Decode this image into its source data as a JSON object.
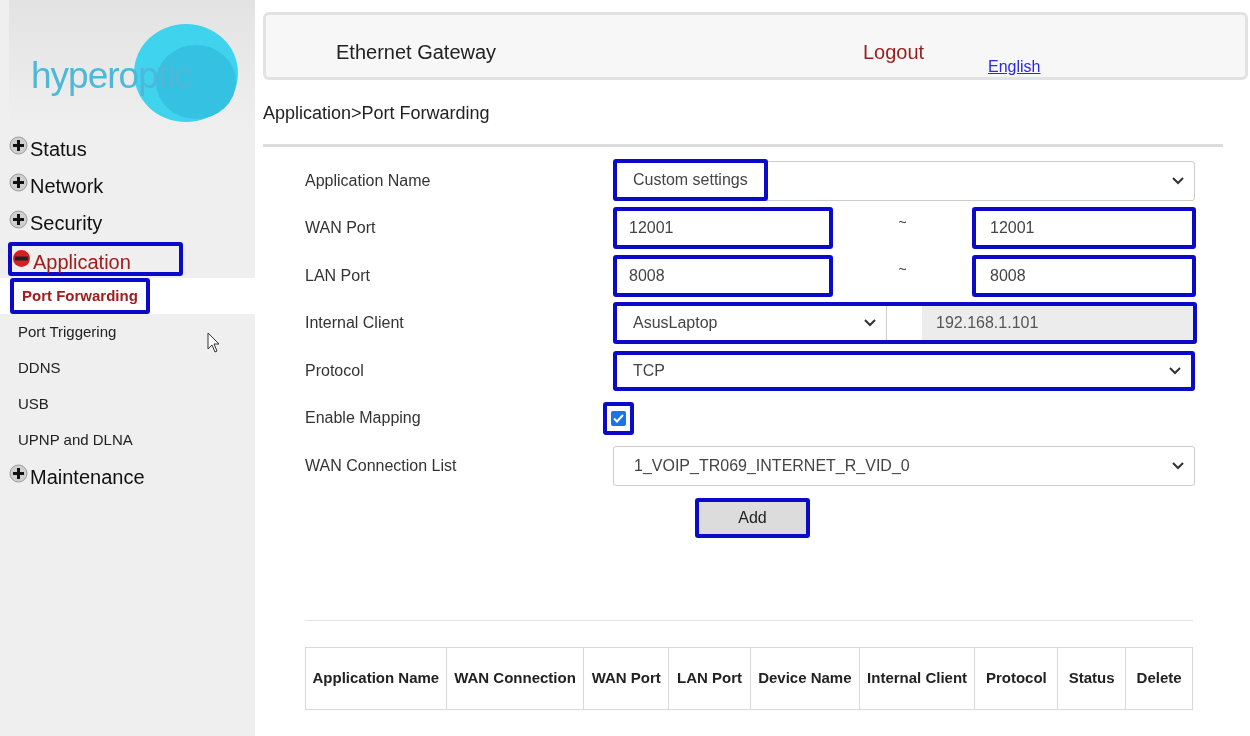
{
  "logo": {
    "text": "hyperoptic"
  },
  "sidebar": {
    "items": [
      {
        "label": "Status",
        "expanded": false,
        "highlighted": false
      },
      {
        "label": "Network",
        "expanded": false,
        "highlighted": false
      },
      {
        "label": "Security",
        "expanded": false,
        "highlighted": false
      },
      {
        "label": "Application",
        "expanded": true,
        "highlighted": true,
        "children": [
          {
            "label": "Port Forwarding",
            "selected": true,
            "highlighted": true
          },
          {
            "label": "Port Triggering",
            "selected": false,
            "highlighted": false
          },
          {
            "label": "DDNS",
            "selected": false,
            "highlighted": false
          },
          {
            "label": "USB",
            "selected": false,
            "highlighted": false
          },
          {
            "label": "UPNP and DLNA",
            "selected": false,
            "highlighted": false
          }
        ]
      },
      {
        "label": "Maintenance",
        "expanded": false,
        "highlighted": false
      }
    ]
  },
  "header": {
    "title": "Ethernet Gateway",
    "logout": "Logout",
    "language": "English"
  },
  "breadcrumb": "Application>Port Forwarding",
  "form": {
    "rows": [
      {
        "kind": "select",
        "label": "Application Name",
        "value": "Custom settings",
        "highlighted": false,
        "value_highlighted": true
      },
      {
        "kind": "range",
        "label": "WAN Port",
        "from": "12001",
        "separator": "~",
        "to": "12001",
        "highlighted": true
      },
      {
        "kind": "range",
        "label": "LAN Port",
        "from": "8008",
        "separator": "~",
        "to": "8008",
        "highlighted": true
      },
      {
        "kind": "client",
        "label": "Internal Client",
        "device": "AsusLaptop",
        "ip": "192.168.1.101",
        "highlighted": true
      },
      {
        "kind": "select",
        "label": "Protocol",
        "value": "TCP",
        "highlighted": true,
        "value_highlighted": false
      },
      {
        "kind": "checkbox",
        "label": "Enable Mapping",
        "checked": true,
        "highlighted": true
      },
      {
        "kind": "select",
        "label": "WAN Connection List",
        "value": "1_VOIP_TR069_INTERNET_R_VID_0",
        "highlighted": false,
        "value_highlighted": false
      }
    ]
  },
  "add_button": {
    "label": "Add",
    "highlighted": true
  },
  "table": {
    "columns": [
      "Application Name",
      "WAN Connection",
      "WAN Port",
      "LAN Port",
      "Device Name",
      "Internal Client",
      "Protocol",
      "Status",
      "Delete"
    ]
  }
}
